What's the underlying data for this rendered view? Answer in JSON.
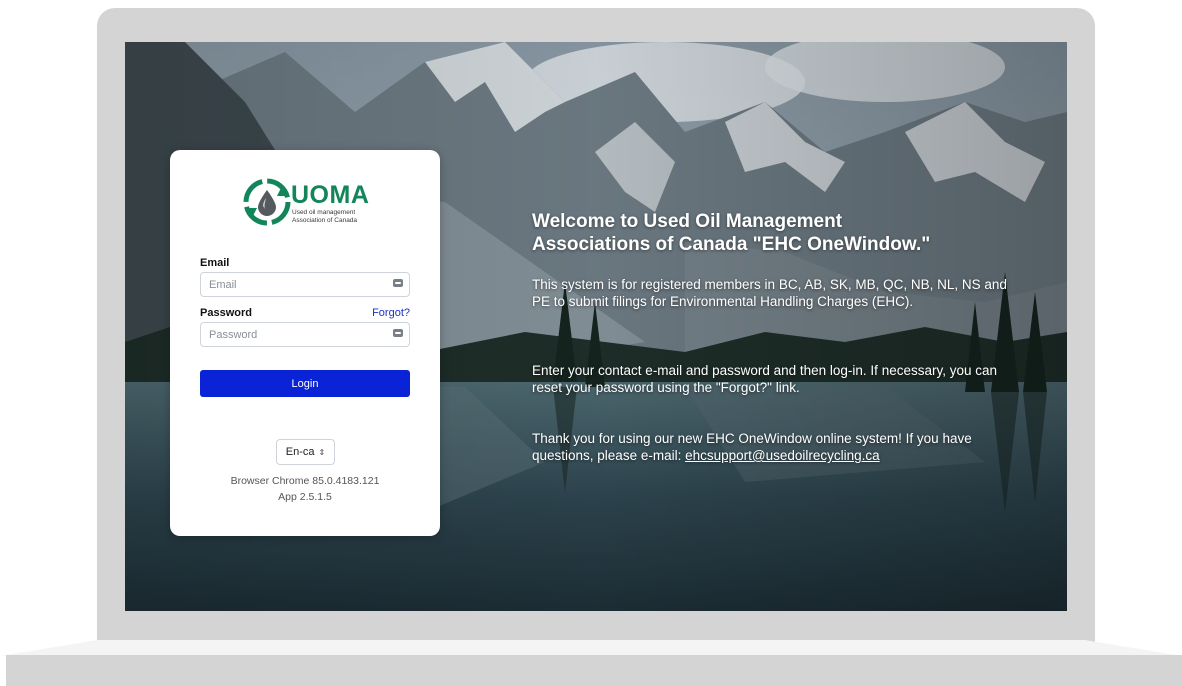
{
  "login": {
    "logo": {
      "name": "UOMA",
      "subtitle_line1": "Used oil management",
      "subtitle_line2": "Association of Canada",
      "icon": "recycle-oil-drop-icon"
    },
    "email_label": "Email",
    "email_placeholder": "Email",
    "email_value": "",
    "password_label": "Password",
    "password_placeholder": "Password",
    "password_value": "",
    "forgot_label": "Forgot?",
    "login_label": "Login",
    "language_selected": "En-ca",
    "browser_info": "Browser Chrome 85.0.4183.121",
    "app_version": "App 2.5.1.5"
  },
  "welcome": {
    "title_line1": "Welcome to Used Oil Management",
    "title_line2": "Associations of Canada \"EHC OneWindow.\"",
    "para1": "This system is for registered members in BC, AB, SK, MB, QC, NB, NL, NS and PE to submit filings for Environmental Handling Charges (EHC).",
    "para2": "Enter your contact e-mail and password and then log-in. If necessary, you can reset your password using the \"Forgot?\" link.",
    "para3_prefix": "Thank you for using our new EHC OneWindow online system! If you have questions, please e-mail: ",
    "support_email": "ehcsupport@usedoilrecycling.ca"
  },
  "colors": {
    "brand_green": "#12865a",
    "login_button": "#0a23d6",
    "forgot_link": "#1a33c8"
  }
}
